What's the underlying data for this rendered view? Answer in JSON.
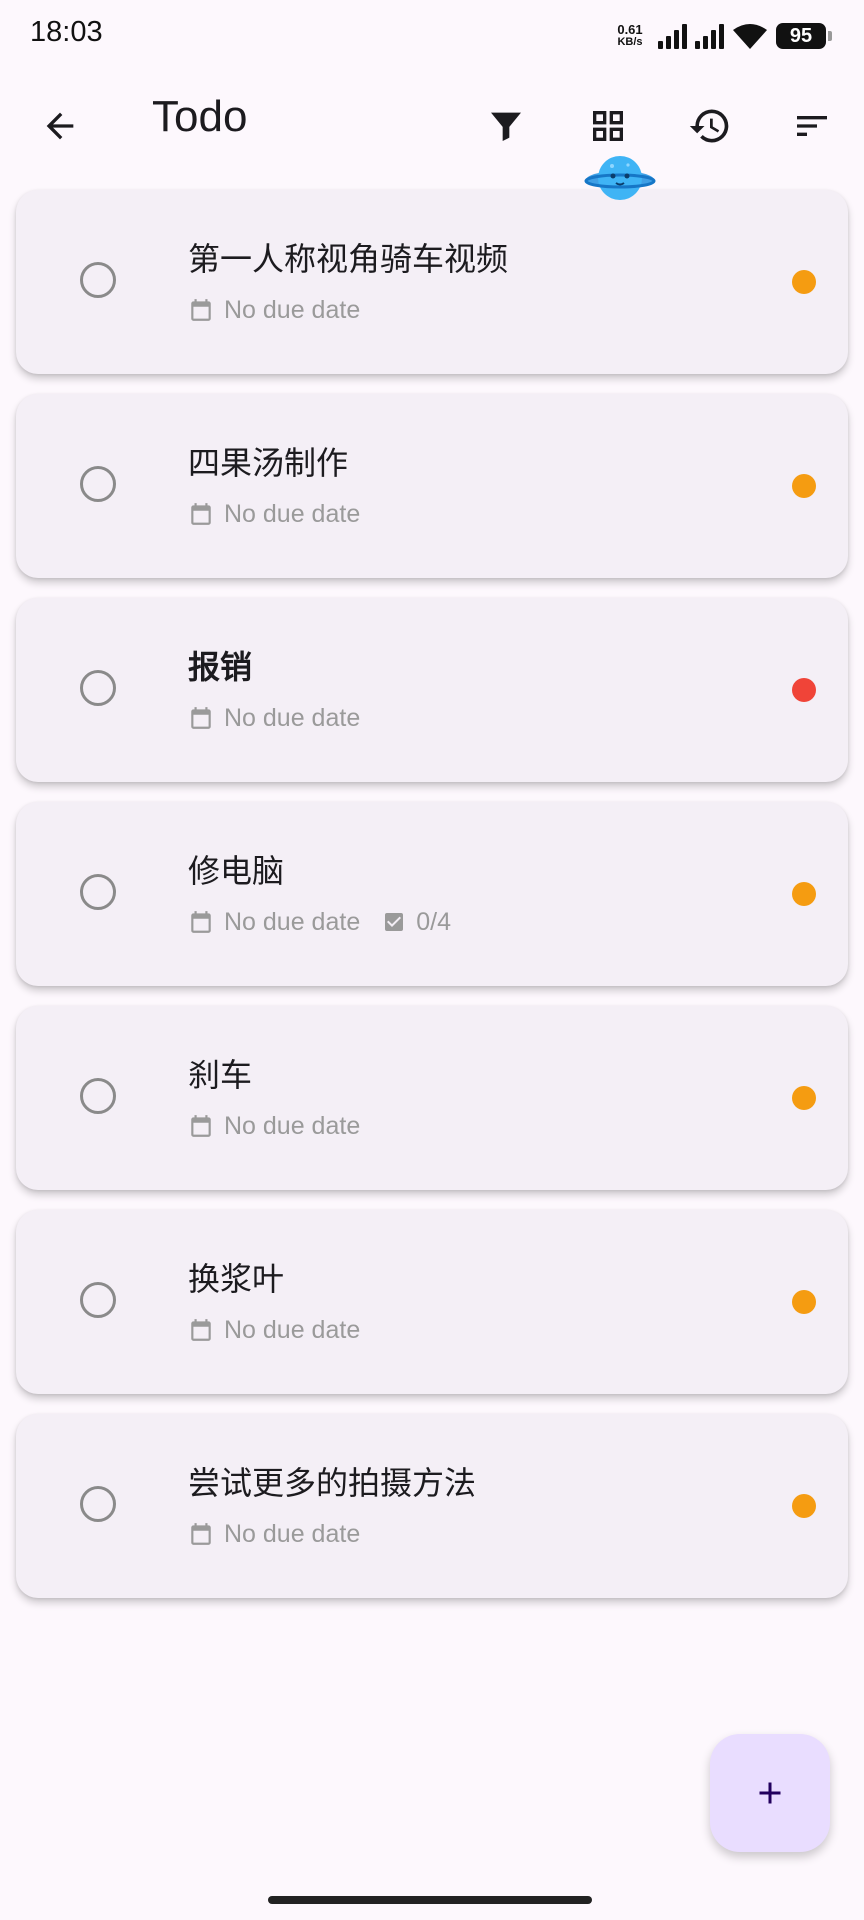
{
  "status_bar": {
    "time": "18:03",
    "net_speed_value": "0.61",
    "net_speed_unit": "KB/s",
    "battery": "95"
  },
  "app_bar": {
    "title": "Todo",
    "icons": [
      "back-arrow-icon",
      "filter-icon",
      "grid-view-icon",
      "history-icon",
      "sort-icon"
    ]
  },
  "todos": [
    {
      "title": "第一人称视角骑车视频",
      "due": "No due date",
      "subtasks": null,
      "priority_color": "#f59c11",
      "bold": false
    },
    {
      "title": "四果汤制作",
      "due": "No due date",
      "subtasks": null,
      "priority_color": "#f59c11",
      "bold": false
    },
    {
      "title": "报销",
      "due": "No due date",
      "subtasks": null,
      "priority_color": "#f04438",
      "bold": true
    },
    {
      "title": "修电脑",
      "due": "No due date",
      "subtasks": "0/4",
      "priority_color": "#f59c11",
      "bold": false
    },
    {
      "title": "刹车",
      "due": "No due date",
      "subtasks": null,
      "priority_color": "#f59c11",
      "bold": false
    },
    {
      "title": "换浆叶",
      "due": "No due date",
      "subtasks": null,
      "priority_color": "#f59c11",
      "bold": false
    },
    {
      "title": "尝试更多的拍摄方法",
      "due": "No due date",
      "subtasks": null,
      "priority_color": "#f59c11",
      "bold": false
    }
  ],
  "colors": {
    "background": "#fdf8fd",
    "card": "#f4eff6",
    "fab": "#e9ddff",
    "priority_high": "#f04438",
    "priority_medium": "#f59c11"
  },
  "fab": {
    "icon": "plus-icon"
  }
}
